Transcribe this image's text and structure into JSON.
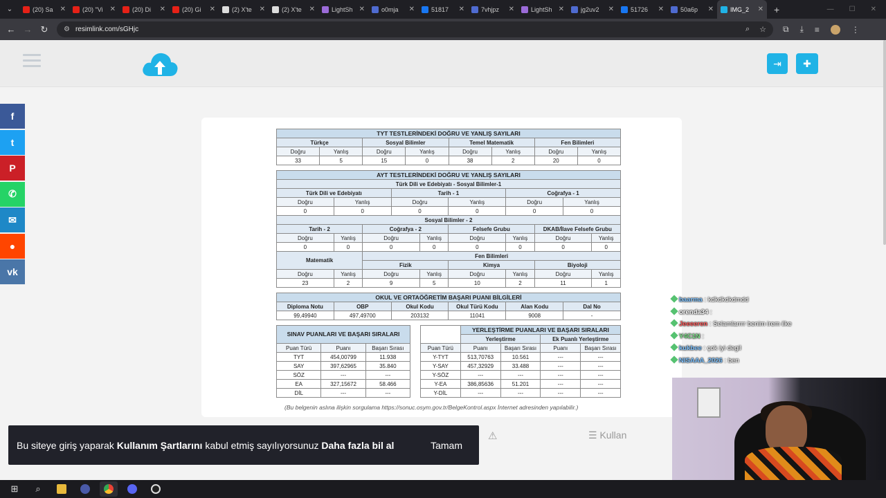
{
  "browser": {
    "tabs": [
      {
        "label": "(20) Sa",
        "fav_color": "#e62117"
      },
      {
        "label": "(20) \"Vi",
        "fav_color": "#e62117"
      },
      {
        "label": "(20) Di",
        "fav_color": "#e62117"
      },
      {
        "label": "(20) Gi",
        "fav_color": "#e62117"
      },
      {
        "label": "(2) X'te",
        "fav_color": "#dddddd"
      },
      {
        "label": "(2) X'te",
        "fav_color": "#dddddd"
      },
      {
        "label": "LightSh",
        "fav_color": "#9b6bd8"
      },
      {
        "label": "o0mja",
        "fav_color": "#4f6bd0"
      },
      {
        "label": "51817",
        "fav_color": "#1877f2"
      },
      {
        "label": "7vhjpz",
        "fav_color": "#4f6bd0"
      },
      {
        "label": "LightSh",
        "fav_color": "#9b6bd8"
      },
      {
        "label": "jg2uv2",
        "fav_color": "#4f6bd0"
      },
      {
        "label": "51726",
        "fav_color": "#1877f2"
      },
      {
        "label": "50a6p",
        "fav_color": "#4f6bd0"
      },
      {
        "label": "IMG_2",
        "fav_color": "#20b3e6"
      }
    ],
    "tab_close": "✕",
    "new_tab": "+",
    "url": "resimlink.com/sGHjc"
  },
  "document": {
    "tyt": {
      "title": "TYT TESTLERİNDEKİ DOĞRU VE YANLIŞ SAYILARI",
      "subjects": [
        "Türkçe",
        "Sosyal Bilimler",
        "Temel Matematik",
        "Fen Bilimleri"
      ],
      "dogru": "Doğru",
      "yanlis": "Yanlış",
      "values": [
        "33",
        "5",
        "15",
        "0",
        "38",
        "2",
        "20",
        "0"
      ]
    },
    "ayt": {
      "title": "AYT TESTLERİNDEKİ DOĞRU VE YANLIŞ SAYILARI",
      "sub1": "Türk Dili ve Edebiyatı - Sosyal Bilimler-1",
      "s1_subjects": [
        "Türk Dili ve Edebiyatı",
        "Tarih - 1",
        "Coğrafya - 1"
      ],
      "s1_values": [
        "0",
        "0",
        "0",
        "0",
        "0",
        "0"
      ],
      "sub2": "Sosyal Bilimler - 2",
      "s2_subjects": [
        "Tarih - 2",
        "Coğrafya - 2",
        "Felsefe Grubu",
        "DKAB/İlave Felsefe Grubu"
      ],
      "s2_values": [
        "0",
        "0",
        "0",
        "0",
        "0",
        "0",
        "0",
        "0"
      ],
      "mat": "Matematik",
      "fen": "Fen Bilimleri",
      "fen_subjects": [
        "Fizik",
        "Kimya",
        "Biyoloji"
      ],
      "s3_values": [
        "23",
        "2",
        "9",
        "5",
        "10",
        "2",
        "11",
        "1"
      ]
    },
    "obp": {
      "title": "OKUL VE ORTAÖĞRETİM BAŞARI PUANI BİLGİLERİ",
      "headers": [
        "Diploma Notu",
        "OBP",
        "Okul Kodu",
        "Okul Türü Kodu",
        "Alan Kodu",
        "Dal No"
      ],
      "values": [
        "99,49940",
        "497,49700",
        "203132",
        "11041",
        "9008",
        "-"
      ]
    },
    "sinav": {
      "title": "SINAV PUANLARI VE BAŞARI SIRALARI",
      "headers": [
        "Puan Türü",
        "Puanı",
        "Başarı Sırası"
      ],
      "rows": [
        [
          "TYT",
          "454,00799",
          "11.938"
        ],
        [
          "SAY",
          "397,62965",
          "35.840"
        ],
        [
          "SÖZ",
          "---",
          "---"
        ],
        [
          "EA",
          "327,15672",
          "58.466"
        ],
        [
          "DİL",
          "---",
          "---"
        ]
      ]
    },
    "yerlestirme": {
      "title": "YERLEŞTİRME PUANLARI VE BAŞARI SIRALARI",
      "group1": "Yerleştirme",
      "group2": "Ek Puanlı Yerleştirme",
      "headers": [
        "Puan Türü",
        "Puanı",
        "Başarı Sırası",
        "Puanı",
        "Başarı Sırası"
      ],
      "rows": [
        [
          "Y-TYT",
          "513,70763",
          "10.561",
          "---",
          "---"
        ],
        [
          "Y-SAY",
          "457,32929",
          "33.488",
          "---",
          "---"
        ],
        [
          "Y-SÖZ",
          "---",
          "---",
          "---",
          "---"
        ],
        [
          "Y-EA",
          "386,85636",
          "51.201",
          "---",
          "---"
        ],
        [
          "Y-DİL",
          "---",
          "---",
          "---",
          "---"
        ]
      ]
    },
    "note": "(Bu belgenin aslına ilişkin sorgulama https://sonuc.osym.gov.tr/BelgeKontrol.aspx İnternet adresinden yapılabilir.)"
  },
  "chat": [
    {
      "user": "baarma",
      "text": "kdkdkdkdmdd",
      "color": "#7fc3ff"
    },
    {
      "user": "orenda34",
      "text": "",
      "color": "#ffffff"
    },
    {
      "user": "Jeeeeren",
      "text": "Selamlarrrr benim irem ilke",
      "color": "#ff5a5a"
    },
    {
      "user": "Y4C1N",
      "text": "",
      "color": "#7fe28a"
    },
    {
      "user": "kukbee",
      "text": "çok iyi degil",
      "color": "#7fc3ff"
    },
    {
      "user": "NISAAA_2026",
      "text": "ben",
      "color": "#7fc3ff"
    }
  ],
  "cookie": {
    "t1": "Bu siteye giriş yaparak ",
    "t2": "Kullanım Şartlarını",
    "t3": " kabul etmiş sayılıyorsunuz ",
    "t4": "Daha fazla bil al",
    "ok": "Tamam"
  },
  "kullan": "☰ Kullan",
  "social": [
    {
      "name": "facebook",
      "glyph": "f",
      "color": "#3b5998"
    },
    {
      "name": "twitter",
      "glyph": "t",
      "color": "#1da1f2"
    },
    {
      "name": "pinterest",
      "glyph": "P",
      "color": "#cb2027"
    },
    {
      "name": "whatsapp",
      "glyph": "✆",
      "color": "#25d366"
    },
    {
      "name": "email",
      "glyph": "✉",
      "color": "#1e88c7"
    },
    {
      "name": "reddit",
      "glyph": "●",
      "color": "#ff4500"
    },
    {
      "name": "vk",
      "glyph": "vk",
      "color": "#4a76a8"
    }
  ]
}
